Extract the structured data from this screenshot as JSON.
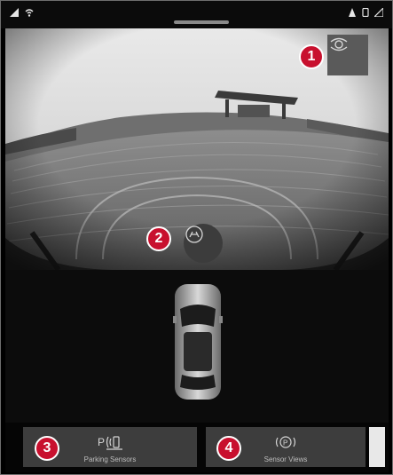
{
  "callouts": [
    "1",
    "2",
    "3",
    "4"
  ],
  "icons": {
    "signal": "signal-icon",
    "wifi": "wifi-icon",
    "status_right": "status-icons",
    "camera_switch": "camera-switch-icon",
    "guide_lines": "guide-lines-icon",
    "park_assist": "park-assist-icon",
    "p_circle": "parking-circle-icon"
  },
  "buttons": {
    "park_label": "Parking Sensors",
    "view_label": "Sensor Views"
  },
  "colors": {
    "callout": "#c8102e",
    "panel": "#3d3d3d",
    "background": "#000000"
  }
}
